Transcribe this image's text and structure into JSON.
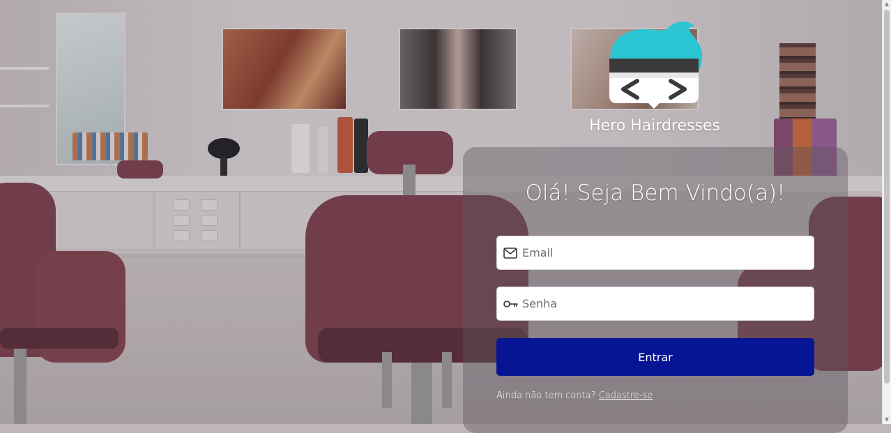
{
  "brand": {
    "name": "Hero Hairdresses",
    "logo_icon": "hero-face-code-logo-icon"
  },
  "login": {
    "heading": "Olá! Seja Bem Vindo(a)!",
    "email": {
      "placeholder": "Email",
      "value": "",
      "icon": "envelope-icon"
    },
    "password": {
      "placeholder": "Senha",
      "value": "",
      "icon": "key-icon"
    },
    "submit_label": "Entrar",
    "signup_prompt": "Ainda não tem conta?",
    "signup_link": "Cadastre-se"
  },
  "colors": {
    "primary_button": "#061594",
    "logo_hair": "#2cc5d3",
    "logo_face": "#ffffff",
    "panel_overlay": "rgba(92,86,92,0.42)",
    "text_light": "#ffffff"
  }
}
